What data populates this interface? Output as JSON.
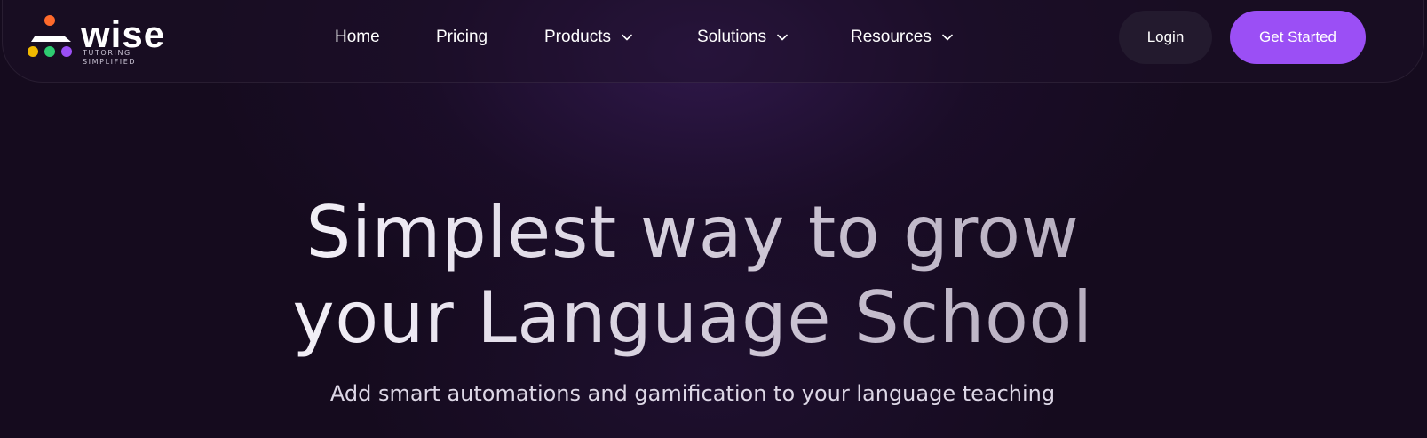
{
  "brand": {
    "name": "wise",
    "tagline": "TUTORING SIMPLIFIED",
    "logo_icon": "wise-logo-icon",
    "dot_colors": [
      "#f0b800",
      "#2ecc71",
      "#9b4ff5"
    ],
    "head_color": "#ff6a2b"
  },
  "nav": {
    "items": [
      {
        "label": "Home",
        "has_dropdown": false
      },
      {
        "label": "Pricing",
        "has_dropdown": false
      },
      {
        "label": "Products",
        "has_dropdown": true
      },
      {
        "label": "Solutions",
        "has_dropdown": true
      },
      {
        "label": "Resources",
        "has_dropdown": true
      }
    ],
    "login_label": "Login",
    "cta_label": "Get Started"
  },
  "hero": {
    "title_line1": "Simplest way to grow",
    "title_line2": "your Language School",
    "subtitle": "Add smart automations and gamification to your language teaching"
  },
  "colors": {
    "accent": "#9b4ff5",
    "background": "#150b1e",
    "login_bg": "#231a2e"
  }
}
